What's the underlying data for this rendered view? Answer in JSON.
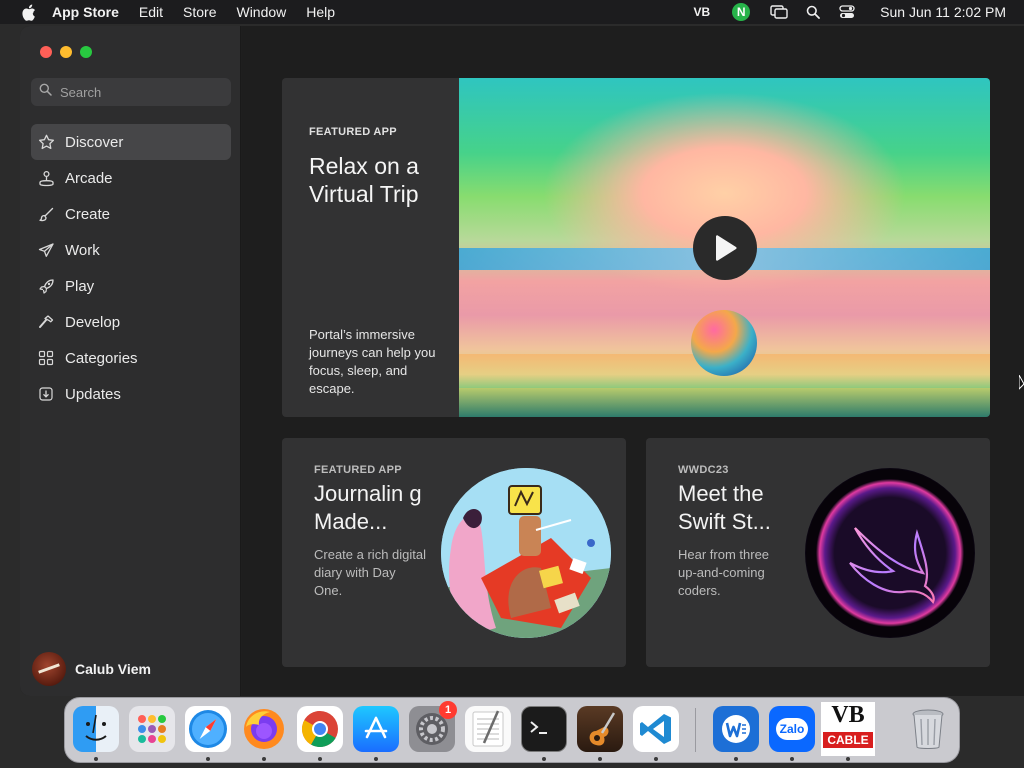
{
  "menubar": {
    "app_name": "App Store",
    "items": [
      "Edit",
      "Store",
      "Window",
      "Help"
    ],
    "vb_label": "VB",
    "n_label": "N",
    "clock": "Sun Jun 11  2:02 PM"
  },
  "sidebar": {
    "search_placeholder": "Search",
    "items": [
      {
        "label": "Discover",
        "icon": "star-icon",
        "active": true
      },
      {
        "label": "Arcade",
        "icon": "joystick-icon"
      },
      {
        "label": "Create",
        "icon": "brush-icon"
      },
      {
        "label": "Work",
        "icon": "paper-plane-icon"
      },
      {
        "label": "Play",
        "icon": "rocket-icon"
      },
      {
        "label": "Develop",
        "icon": "hammer-icon"
      },
      {
        "label": "Categories",
        "icon": "grid-icon"
      },
      {
        "label": "Updates",
        "icon": "download-icon"
      }
    ],
    "user_name": "Calub Viem"
  },
  "hero": {
    "eyebrow": "FEATURED APP",
    "title": "Relax on a Virtual Trip",
    "description": "Portal’s immersive journeys can help you focus, sleep, and escape."
  },
  "cards": [
    {
      "eyebrow": "FEATURED APP",
      "title": "Journalin g Made...",
      "description": "Create a rich digital diary with Day One."
    },
    {
      "eyebrow": "WWDC23",
      "title": "Meet the Swift St...",
      "description": "Hear from three up-and-coming coders."
    }
  ],
  "dock": {
    "apps": [
      "finder-icon",
      "launchpad-icon",
      "safari-icon",
      "firefox-icon",
      "chrome-icon",
      "app-store-icon",
      "system-settings-icon",
      "textedit-icon",
      "terminal-icon",
      "garageband-icon",
      "vscode-icon",
      "word-icon",
      "zalo-icon",
      "vb-cable-icon",
      "trash-icon"
    ],
    "settings_badge": "1",
    "zalo_label": "Zalo",
    "vb_top": "VB",
    "vb_bottom": "CABLE"
  }
}
